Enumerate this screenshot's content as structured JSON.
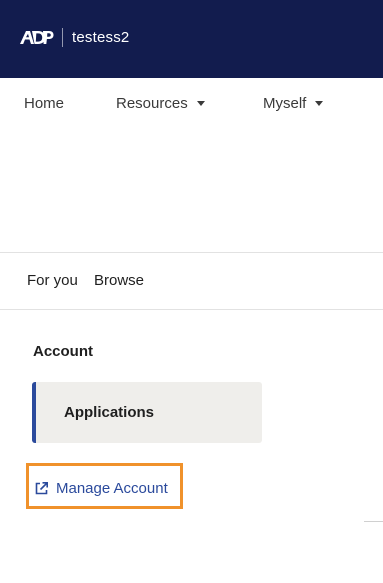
{
  "header": {
    "logo_icon": "adp-logo-icon",
    "username": "testess2",
    "background_color": "#121c4e"
  },
  "nav": {
    "items": [
      {
        "label": "Home",
        "has_dropdown": false
      },
      {
        "label": "Resources",
        "has_dropdown": true
      },
      {
        "label": "Myself",
        "has_dropdown": true
      }
    ]
  },
  "subtabs": {
    "items": [
      {
        "label": "For you"
      },
      {
        "label": "Browse"
      }
    ]
  },
  "account": {
    "heading": "Account",
    "applications_label": "Applications",
    "manage_account_label": "Manage Account",
    "manage_account_icon": "external-link-icon",
    "accent_color": "#2b4a9c",
    "highlight_color": "#f0922b"
  }
}
